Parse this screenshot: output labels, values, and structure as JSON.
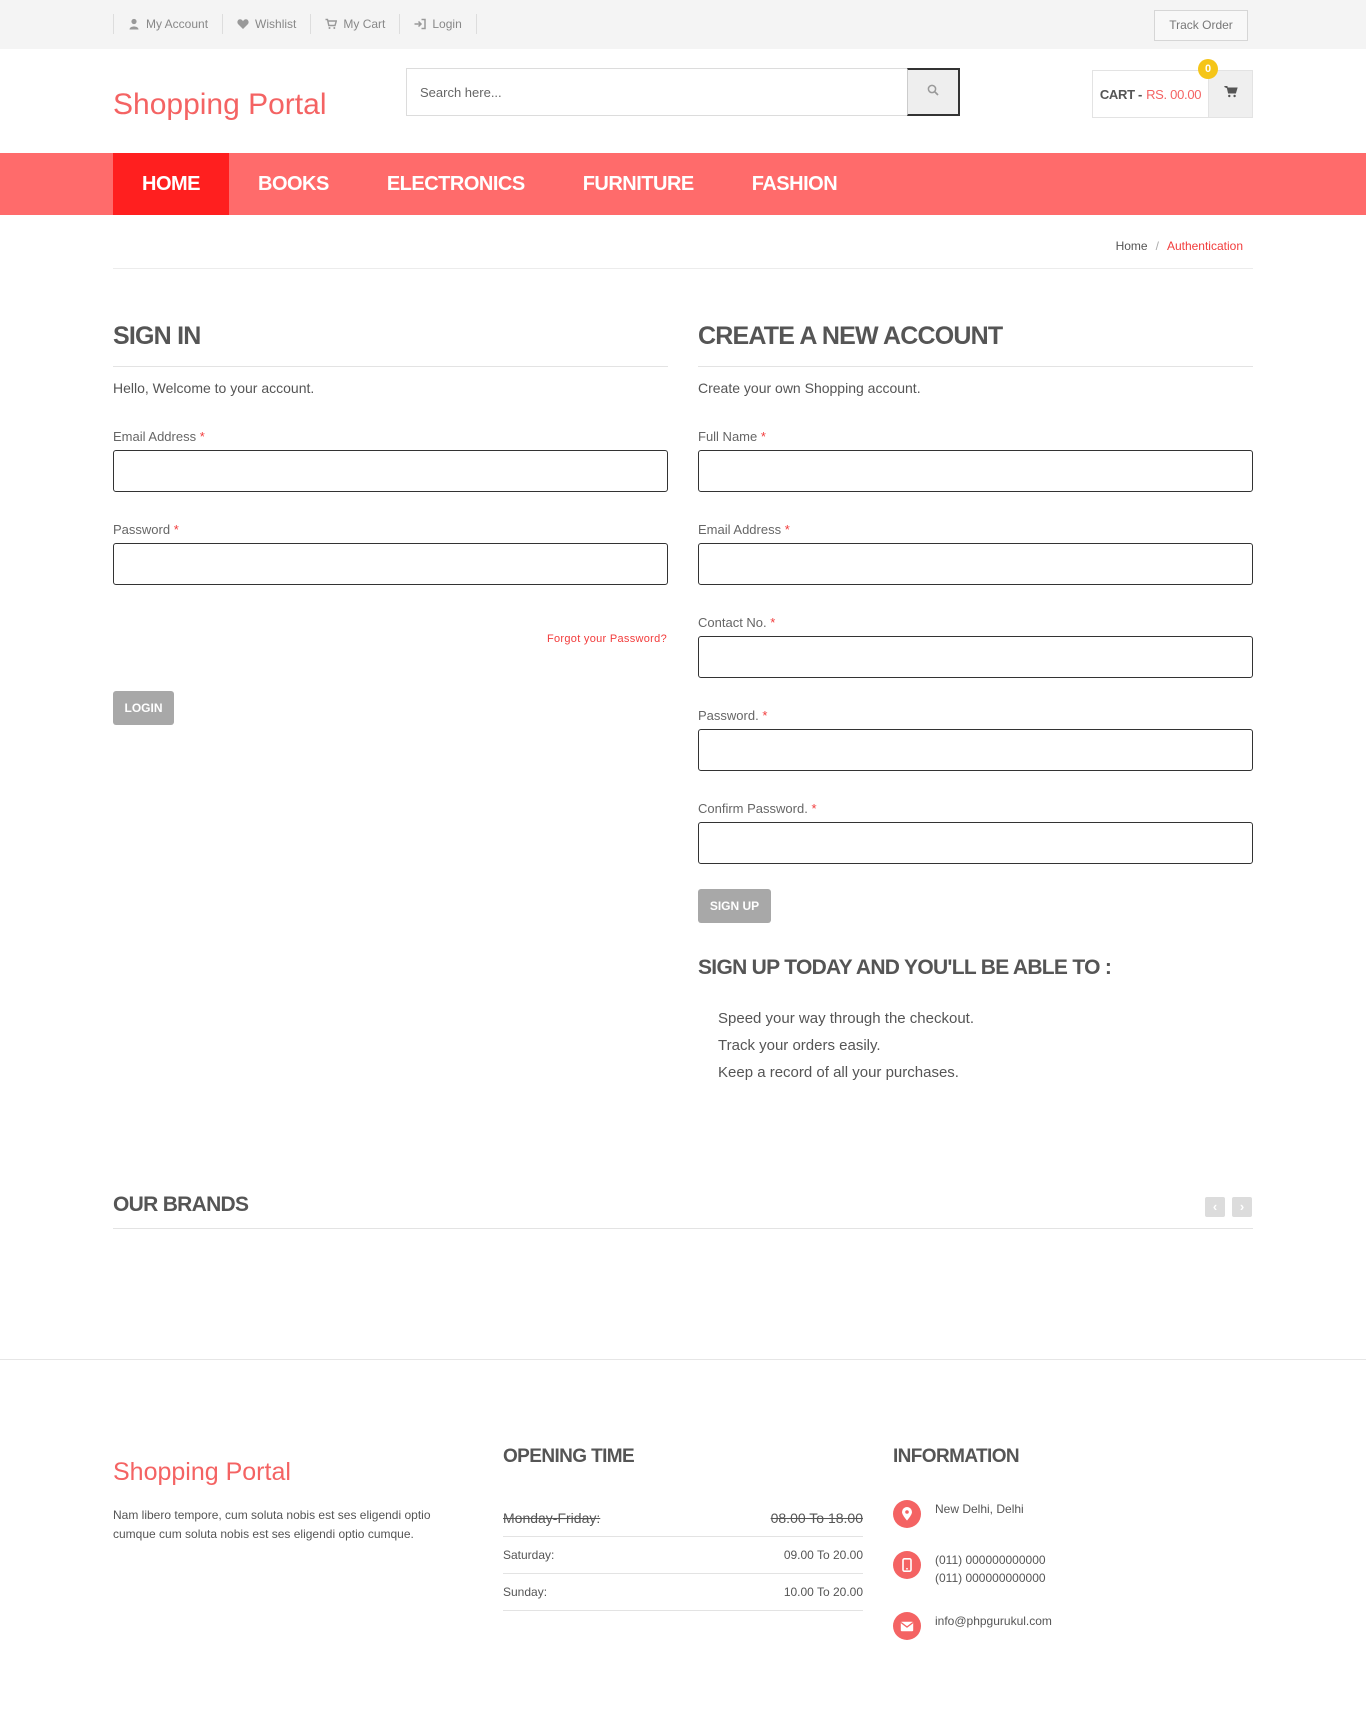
{
  "topbar": {
    "links": [
      {
        "label": "My Account",
        "icon": "user-icon"
      },
      {
        "label": "Wishlist",
        "icon": "heart-icon"
      },
      {
        "label": "My Cart",
        "icon": "cart-icon"
      },
      {
        "label": "Login",
        "icon": "login-icon"
      }
    ],
    "track_order": "Track Order"
  },
  "header": {
    "logo": "Shopping Portal",
    "search_placeholder": "Search here...",
    "cart_label": "CART -",
    "cart_amount": "RS. 00.00",
    "cart_count": "0"
  },
  "nav": {
    "items": [
      "HOME",
      "BOOKS",
      "ELECTRONICS",
      "FURNITURE",
      "FASHION"
    ],
    "active": "HOME"
  },
  "breadcrumb": {
    "home": "Home",
    "separator": "/",
    "current": "Authentication"
  },
  "signin": {
    "title": "SIGN IN",
    "intro": "Hello, Welcome to your account.",
    "email_label": "Email Address",
    "password_label": "Password",
    "required_mark": "*",
    "forgot": "Forgot your Password?",
    "login_button": "LOGIN"
  },
  "signup": {
    "title": "CREATE A NEW ACCOUNT",
    "intro": "Create your own Shopping account.",
    "fullname_label": "Full Name",
    "email_label": "Email Address",
    "contact_label": "Contact No.",
    "password_label": "Password.",
    "confirm_label": "Confirm Password.",
    "required_mark": "*",
    "signup_button": "SIGN UP",
    "benefits_title": "SIGN UP TODAY AND YOU'LL BE ABLE TO :",
    "benefits": [
      "Speed your way through the checkout.",
      "Track your orders easily.",
      "Keep a record of all your purchases."
    ]
  },
  "brands": {
    "title": "OUR BRANDS",
    "prev": "‹",
    "next": "›"
  },
  "footer": {
    "logo": "Shopping Portal",
    "description": "Nam libero tempore, cum soluta nobis est ses eligendi optio cumque cum soluta nobis est ses eligendi optio cumque.",
    "opening_title": "OPENING TIME",
    "hours": [
      {
        "day": "Monday-Friday:",
        "time": "08.00 To 18.00"
      },
      {
        "day": "Saturday:",
        "time": "09.00 To 20.00"
      },
      {
        "day": "Sunday:",
        "time": "10.00 To 20.00"
      }
    ],
    "info_title": "INFORMATION",
    "address": "New Delhi, Delhi",
    "phone1": "(011) 000000000000",
    "phone2": "(011) 000000000000",
    "email": "info@phpgurukul.com"
  },
  "colors": {
    "brand": "#f46363",
    "nav_bg": "#ff6b6b",
    "nav_active": "#ff1f1f",
    "badge": "#f5c518",
    "button_grey": "#a8a8a8"
  }
}
